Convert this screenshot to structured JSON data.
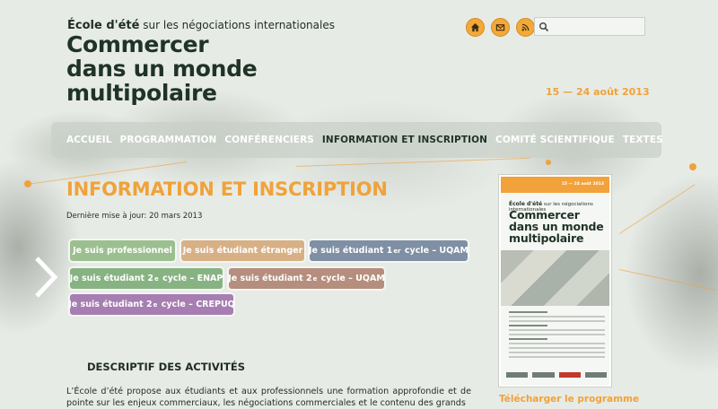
{
  "header": {
    "kicker_bold": "École d'été",
    "kicker_rest": "sur les négociations internationales",
    "title_lines": [
      "Commercer",
      "dans un monde",
      "multipolaire"
    ],
    "dates": "15 — 24 août 2013"
  },
  "search": {
    "placeholder": "",
    "value": ""
  },
  "header_icons": [
    "home-icon",
    "mail-icon",
    "rss-icon"
  ],
  "nav": [
    {
      "label": "ACCUEIL"
    },
    {
      "label": "PROGRAMMATION"
    },
    {
      "label": "CONFÉRENCIERS"
    },
    {
      "label": "INFORMATION ET INSCRIPTION",
      "active": true
    },
    {
      "label": "COMITÉ SCIENTIFIQUE"
    },
    {
      "label": "TEXTES"
    }
  ],
  "main": {
    "title": "INFORMATION ET INSCRIPTION",
    "updated": "Dernière mise à jour: 20 mars 2013",
    "pills": [
      {
        "text": "Je suis professionnel",
        "color": "#9cbf8f"
      },
      {
        "text": "Je suis étudiant étranger",
        "color": "#d8b085"
      },
      {
        "pre": "Je suis étudiant 1",
        "sup": "er",
        "post": "cycle – UQAM",
        "color": "#7f8fa4"
      },
      {
        "pre": "Je suis étudiant 2",
        "sup": "e",
        "post": "cycle – ENAP",
        "color": "#87b382"
      },
      {
        "pre": "Je suis étudiant 2",
        "sup": "e",
        "post": "cycle – UQAM",
        "color": "#b68e7d"
      },
      {
        "pre": "Je suis étudiant 2",
        "sup": "e",
        "post": "cycle – CREPUQ",
        "color": "#a77eb1"
      }
    ],
    "section_title": "DESCRIPTIF DES ACTIVITÉS",
    "body": "L’École d’été propose aux étudiants et aux professionnels une formation approfondie et de pointe sur les enjeux commerciaux, les négociations commerciales et le contenu des grands"
  },
  "poster": {
    "date": "15 — 24 août 2013",
    "kicker_bold": "École d'été",
    "kicker_rest": "sur les négociations internationales",
    "title_lines": [
      "Commercer",
      "dans un monde",
      "multipolaire"
    ]
  },
  "download": {
    "label": "Télécharger le programme"
  },
  "colors": {
    "accent": "#f0a23a",
    "title": "#1f3326"
  }
}
